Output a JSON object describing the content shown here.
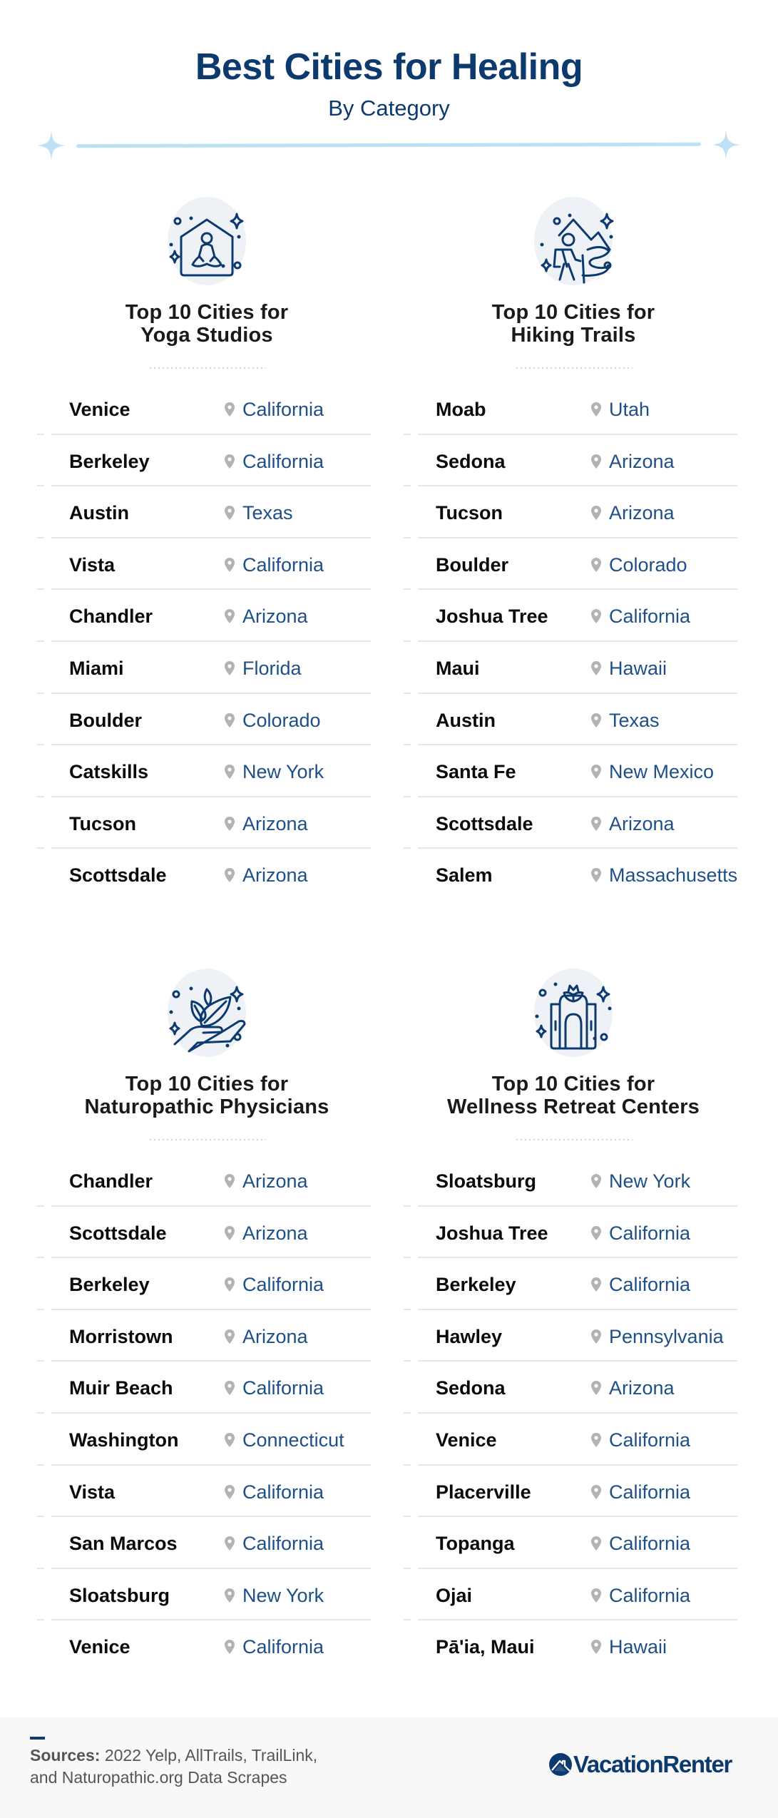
{
  "header": {
    "title": "Best Cities for Healing",
    "subtitle": "By Category"
  },
  "colors": {
    "brand_navy": "#0d3a6e",
    "state_blue": "#1e4f86",
    "accent_light_blue": "#bde0f7",
    "icon_bg": "#eef2f6",
    "pin_gray": "#b3b3b3",
    "footer_bg": "#f8f8f8"
  },
  "sections": [
    {
      "icon": "yoga-house-icon",
      "heading_line1": "Top 10 Cities for",
      "heading_line2": "Yoga Studios",
      "rows": [
        {
          "city": "Venice",
          "state": "California"
        },
        {
          "city": "Berkeley",
          "state": "California"
        },
        {
          "city": "Austin",
          "state": "Texas"
        },
        {
          "city": "Vista",
          "state": "California"
        },
        {
          "city": "Chandler",
          "state": "Arizona"
        },
        {
          "city": "Miami",
          "state": "Florida"
        },
        {
          "city": "Boulder",
          "state": "Colorado"
        },
        {
          "city": "Catskills",
          "state": "New York"
        },
        {
          "city": "Tucson",
          "state": "Arizona"
        },
        {
          "city": "Scottsdale",
          "state": "Arizona"
        }
      ]
    },
    {
      "icon": "hiker-icon",
      "heading_line1": "Top 10 Cities for",
      "heading_line2": "Hiking Trails",
      "rows": [
        {
          "city": "Moab",
          "state": "Utah"
        },
        {
          "city": "Sedona",
          "state": "Arizona"
        },
        {
          "city": "Tucson",
          "state": "Arizona"
        },
        {
          "city": "Boulder",
          "state": "Colorado"
        },
        {
          "city": "Joshua Tree",
          "state": "California"
        },
        {
          "city": "Maui",
          "state": "Hawaii"
        },
        {
          "city": "Austin",
          "state": "Texas"
        },
        {
          "city": "Santa Fe",
          "state": "New Mexico"
        },
        {
          "city": "Scottsdale",
          "state": "Arizona"
        },
        {
          "city": "Salem",
          "state": "Massachusetts"
        }
      ]
    },
    {
      "icon": "hand-leaves-icon",
      "heading_line1": "Top 10 Cities for",
      "heading_line2": "Naturopathic Physicians",
      "rows": [
        {
          "city": "Chandler",
          "state": "Arizona"
        },
        {
          "city": "Scottsdale",
          "state": "Arizona"
        },
        {
          "city": "Berkeley",
          "state": "California"
        },
        {
          "city": "Morristown",
          "state": "Arizona"
        },
        {
          "city": "Muir Beach",
          "state": "California"
        },
        {
          "city": "Washington",
          "state": "Connecticut"
        },
        {
          "city": "Vista",
          "state": "California"
        },
        {
          "city": "San Marcos",
          "state": "California"
        },
        {
          "city": "Sloatsburg",
          "state": "New York"
        },
        {
          "city": "Venice",
          "state": "California"
        }
      ]
    },
    {
      "icon": "retreat-lotus-icon",
      "heading_line1": "Top 10 Cities for",
      "heading_line2": "Wellness Retreat Centers",
      "rows": [
        {
          "city": "Sloatsburg",
          "state": "New York"
        },
        {
          "city": "Joshua Tree",
          "state": "California"
        },
        {
          "city": "Berkeley",
          "state": "California"
        },
        {
          "city": "Hawley",
          "state": "Pennsylvania"
        },
        {
          "city": "Sedona",
          "state": "Arizona"
        },
        {
          "city": "Venice",
          "state": "California"
        },
        {
          "city": "Placerville",
          "state": "California"
        },
        {
          "city": "Topanga",
          "state": "California"
        },
        {
          "city": "Ojai",
          "state": "California"
        },
        {
          "city": "Pā'ia, Maui",
          "state": "Hawaii"
        }
      ]
    }
  ],
  "footer": {
    "sources_label": "Sources:",
    "sources_line1": " 2022 Yelp, AllTrails, TrailLink,",
    "sources_line2": "and Naturopathic.org Data Scrapes",
    "logo_text": "VacationRenter"
  }
}
